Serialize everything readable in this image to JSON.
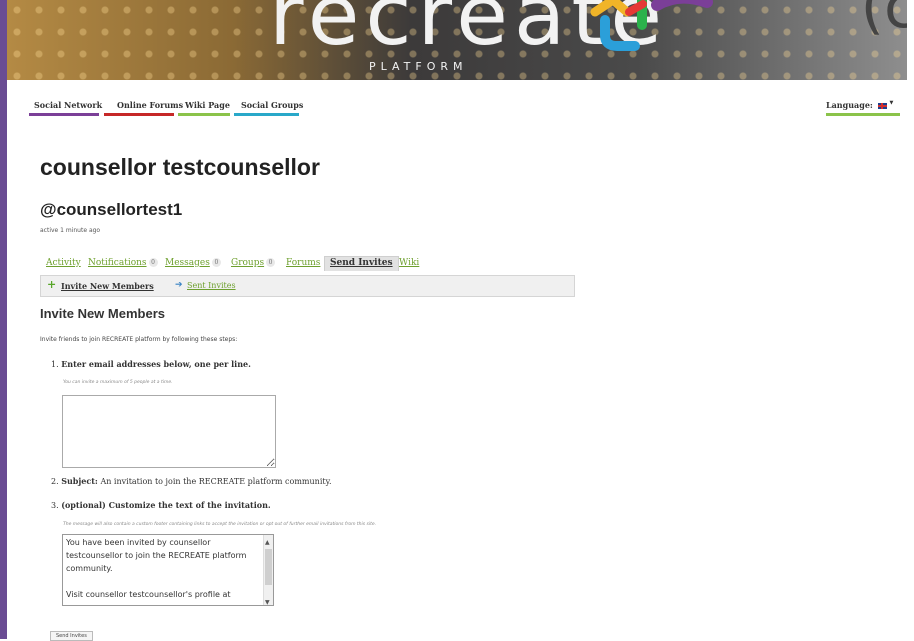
{
  "header": {
    "logo_text": "recreate",
    "logo_sub": "PLATFORM"
  },
  "nav": {
    "items": [
      {
        "label": "Social Network",
        "color": "#7b3f98"
      },
      {
        "label": "Online Forums",
        "color": "#c62828"
      },
      {
        "label": "Wiki Page",
        "color": "#8bc34a"
      },
      {
        "label": "Social Groups",
        "color": "#29a8c9"
      }
    ],
    "language_label": "Language:",
    "language_caret": "▼"
  },
  "profile": {
    "name": "counsellor testcounsellor",
    "handle": "@counsellortest1",
    "active": "active 1 minute ago"
  },
  "tabs": [
    {
      "label": "Activity"
    },
    {
      "label": "Notifications",
      "count": "0"
    },
    {
      "label": "Messages",
      "count": "0"
    },
    {
      "label": "Groups",
      "count": "0"
    },
    {
      "label": "Forums"
    },
    {
      "label": "Send Invites",
      "active": true
    },
    {
      "label": "Wiki"
    }
  ],
  "subnav": {
    "invite_new": "Invite New Members",
    "sent_invites": "Sent Invites"
  },
  "main": {
    "heading": "Invite New Members",
    "intro": "Invite friends to join RECREATE platform by following these steps:",
    "step1_num": "1.",
    "step1_label": "Enter email addresses below, one per line.",
    "step1_hint": "You can invite a maximum of 5 people at a time.",
    "step2_num": "2.",
    "step2_label": "Subject:",
    "step2_value": "An invitation to join the RECREATE platform community.",
    "step3_num": "3.",
    "step3_label": "(optional) Customize the text of the invitation.",
    "step3_hint": "The message will also contain a custom footer containing links to accept the invitation or opt out of further email invitations from this site.",
    "message_text": "You have been invited by counsellor testcounsellor to join the RECREATE platform community.\n\nVisit counsellor testcounsellor's profile at",
    "send_button": "Send Invites"
  }
}
